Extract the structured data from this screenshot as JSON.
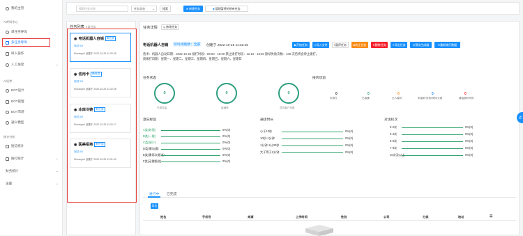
{
  "sidebar": {
    "home": "我的主页",
    "group_ai": "AI呼叫中心",
    "items_ai": [
      "单任务呼叫",
      "多任务呼叫",
      "呼入操作",
      "人工坐席"
    ],
    "group_aic": "AI话术",
    "items_bot": [
      "BOT设计",
      "BOT管理",
      "BOT市场",
      "通义模型"
    ],
    "group_stats": "统计分析",
    "items_stats": [
      "短信统计",
      "拨打统计",
      "财务统计",
      "设置"
    ]
  },
  "topbar": {
    "search_placeholder": "搜索任务名称",
    "status_select": "任务状态",
    "search_btn": "搜索",
    "new_task_btn": "新建任务",
    "manage_btn": "管理暂停的所有任务"
  },
  "task_list": {
    "title": "任务列表",
    "count": "4条任务",
    "cards": [
      {
        "name": "电话机器人自销",
        "tag": "新任务",
        "link": "测试 0/0",
        "meta": "Shuangrui 创建于 2022-10-25 11:32:45"
      },
      {
        "name": "信用卡",
        "tag": "新任务",
        "link": "测试 0/0",
        "meta": "Shuangrui 创建于 2022-10-25 11:32:28"
      },
      {
        "name": "冰库冷链",
        "tag": "新任务",
        "link": "测试 0/0",
        "meta": "Shuangrui 创建于 2022-10-25 11:32:17"
      },
      {
        "name": "医美招商",
        "tag": "新任务",
        "link": "测试 0/0",
        "meta": "Shuangrui 创建于 2022-10-25 11:31:49"
      }
    ]
  },
  "detail": {
    "header": "任务详情",
    "edit_btn": "修改任务",
    "task_name": "电话机器人自销",
    "line_tag": "呼叫线路数：全部",
    "created": "创建于 2022-10-25 11:32:45",
    "actions": [
      "开始任务",
      "导入文件",
      "暂停任务",
      "终止任务",
      "删除任务",
      "导出任务",
      "预览生成器",
      "重新拨打数据"
    ],
    "info_line1": "话术：机器人自动日期：2022-10-25 拨打时段：09:00 - 18:00 禁止拨打时段：12:10 - 13:30 接续失败次数：100 次后将会停止拨打。",
    "info_line2": "周拨打日期：星期一、星期二、星期三、星期四、星期五、星期六、星期日",
    "status_title": "任务状态",
    "circles": [
      {
        "value": "0",
        "label": "已拨总量"
      },
      {
        "value": "0",
        "label": "接通率"
      },
      {
        "value": "0",
        "label": "意向客户总数"
      }
    ],
    "dial_title": "接听状态",
    "dial_stats": [
      {
        "value": "0",
        "label": "未拨打",
        "color": "#333333"
      },
      {
        "value": "0",
        "label": "已接通",
        "color": "#2fa36b"
      },
      {
        "value": "0",
        "label": "无人接听",
        "color": "#fa8c16"
      },
      {
        "value": "0",
        "label": "未接听/关机/停机/欠费",
        "color": "#1890ff"
      },
      {
        "value": "0",
        "label": "通话超时失败",
        "color": "#f5222d"
      }
    ],
    "intent_title": "意向标签",
    "intent_rows": [
      {
        "label": "A类(较强)",
        "value": "0%(0)"
      },
      {
        "label": "B类(一般)",
        "value": "0%(0)"
      },
      {
        "label": "C类(很少)",
        "value": "0%(0)"
      },
      {
        "label": "D类(需沟通)",
        "value": "0%(0)"
      },
      {
        "label": "E类(需再次跟进)",
        "value": "0%(0)"
      },
      {
        "label": "F类(无需跟进)",
        "value": "0%(0)"
      }
    ],
    "duration_title": "通话时长",
    "duration_rows": [
      {
        "label": "小于10秒",
        "value": "0%(0)"
      },
      {
        "label": "10秒-1分钟",
        "value": "0%(0)"
      },
      {
        "label": "1分钟-1分30秒",
        "value": "0%(0)"
      },
      {
        "label": "大于等于2分钟",
        "value": "0%(0)"
      }
    ],
    "rounds_title": "对话轮次",
    "rounds_rows": [
      {
        "label": "0-2次",
        "value": "0%(0)"
      },
      {
        "label": "3-4次",
        "value": "0%(0)"
      },
      {
        "label": "5-6次",
        "value": "0%(0)"
      },
      {
        "label": "7-9次",
        "value": "0%(0)"
      },
      {
        "label": "10次及以上",
        "value": "0%(0)"
      }
    ]
  },
  "bottom": {
    "tabs": [
      "进行中",
      "已完成"
    ],
    "export_btn": "导出",
    "columns": [
      "姓名",
      "手机号",
      "来源",
      "上传时间",
      "性别",
      "公司",
      "分类",
      "地址"
    ]
  }
}
